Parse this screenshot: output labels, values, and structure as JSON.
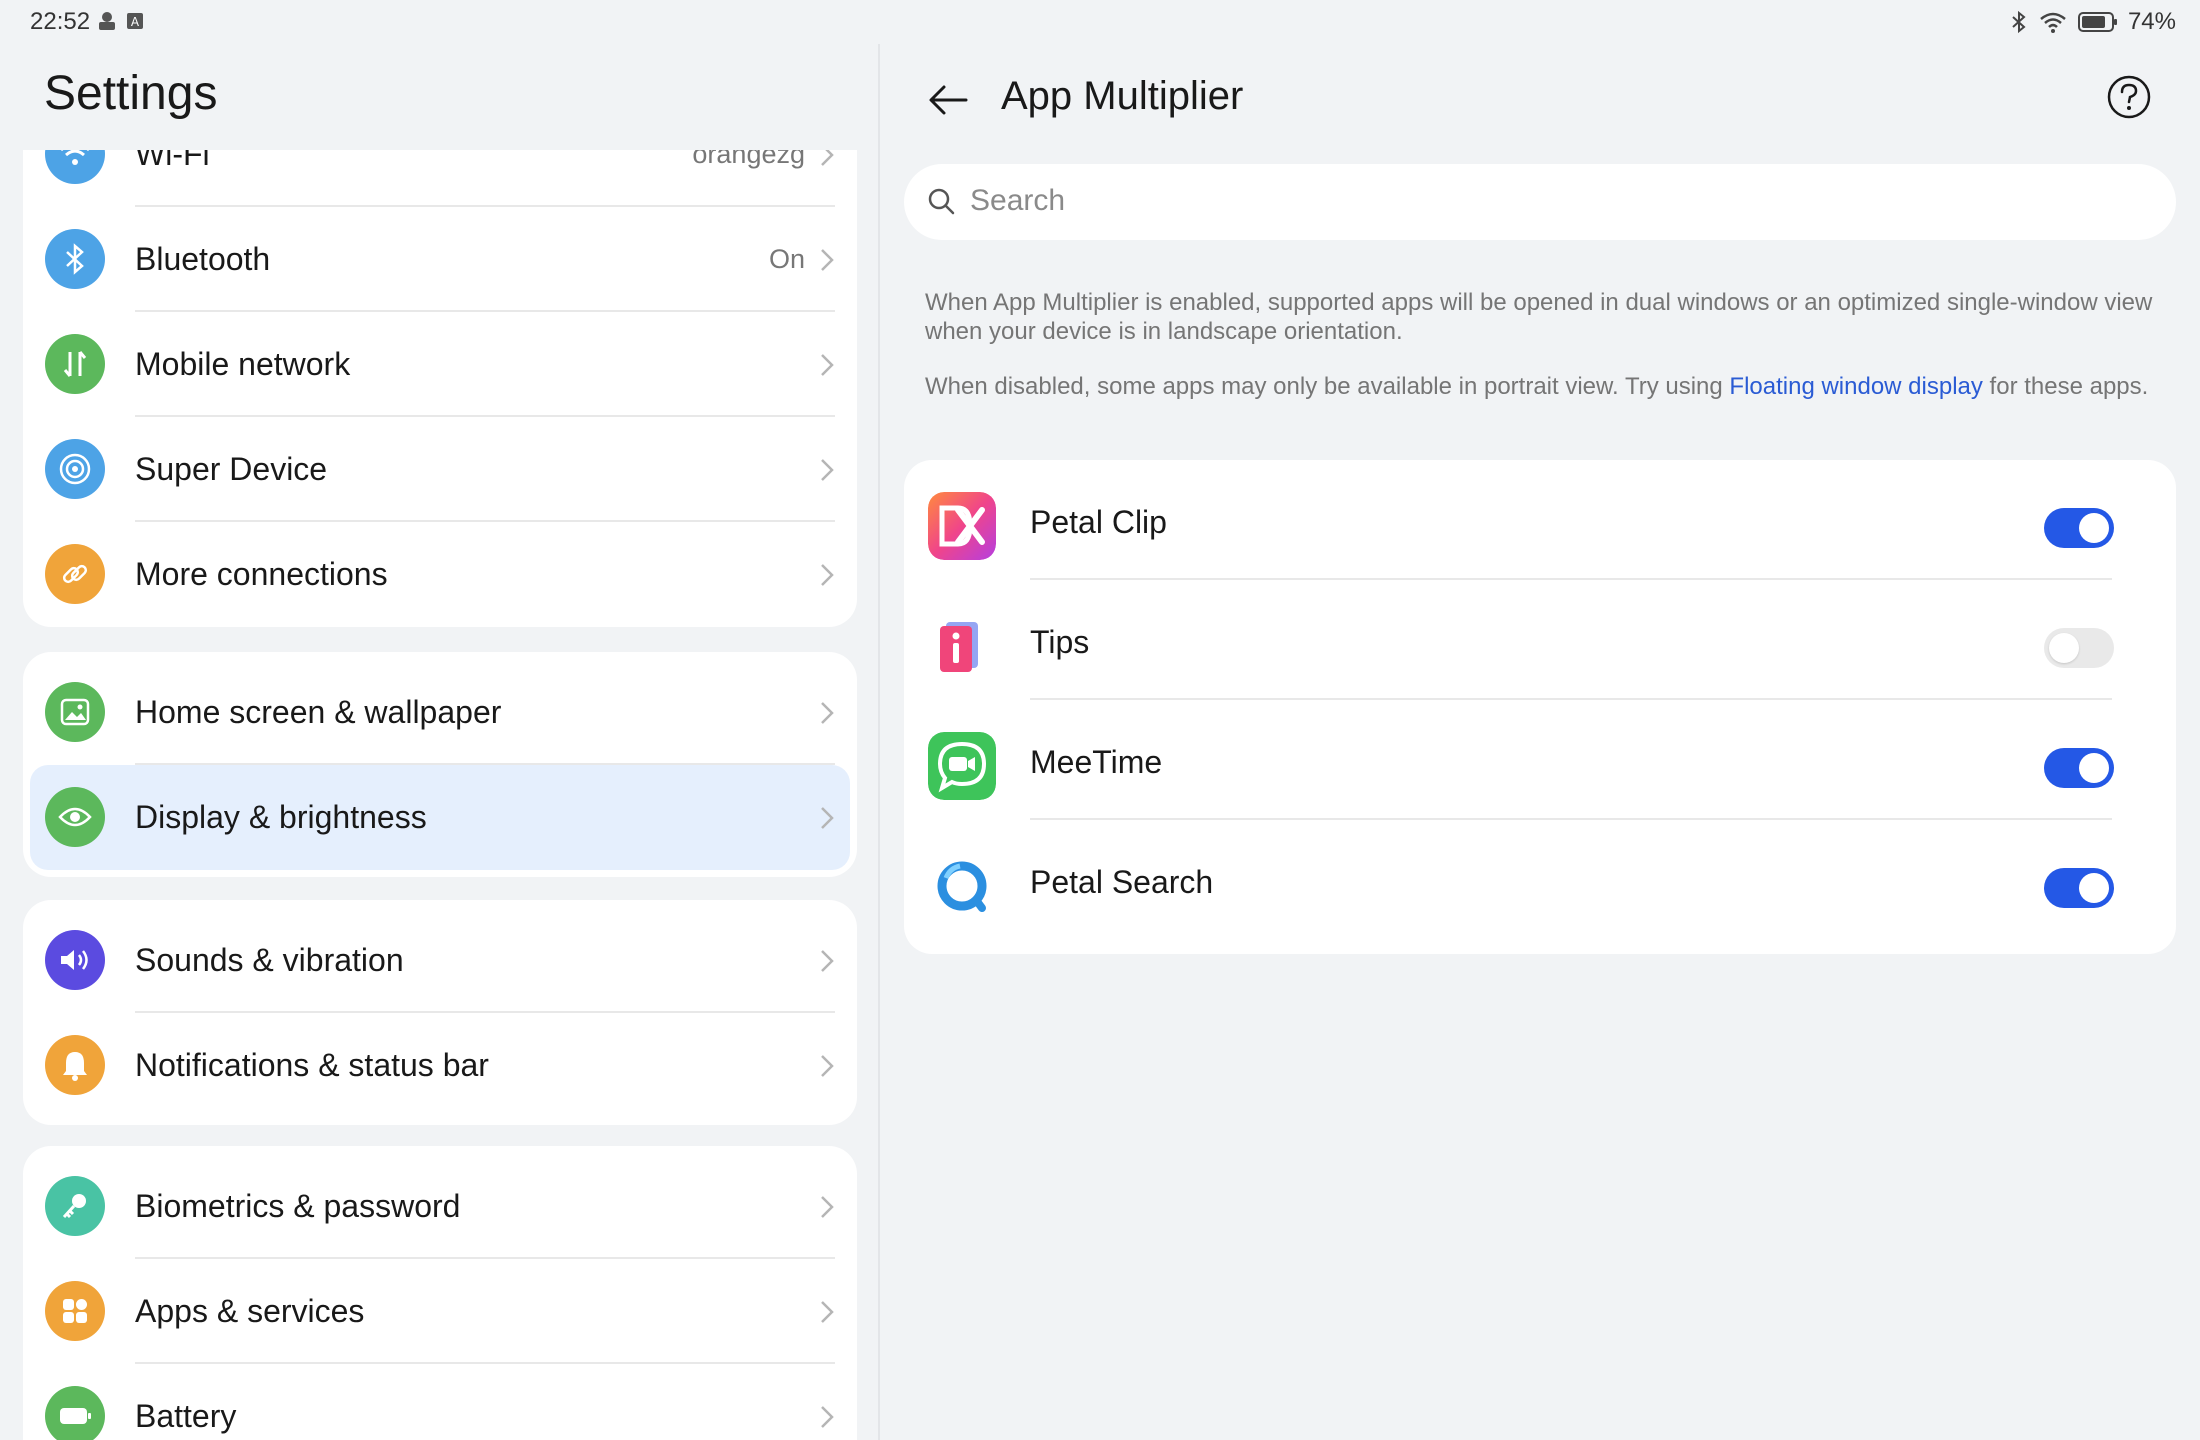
{
  "status_bar": {
    "time": "22:52",
    "battery": "74%"
  },
  "left": {
    "title": "Settings",
    "groups": [
      {
        "items": [
          {
            "label": "Wi-Fi",
            "value": "orangezg",
            "icon": "wifi-icon",
            "color": "#4da3e6"
          },
          {
            "label": "Bluetooth",
            "value": "On",
            "icon": "bluetooth-icon",
            "color": "#4da3e6"
          },
          {
            "label": "Mobile network",
            "value": "",
            "icon": "mobile-network-icon",
            "color": "#5cb85c"
          },
          {
            "label": "Super Device",
            "value": "",
            "icon": "super-device-icon",
            "color": "#4da3e6"
          },
          {
            "label": "More connections",
            "value": "",
            "icon": "link-icon",
            "color": "#f0a43a"
          }
        ]
      },
      {
        "items": [
          {
            "label": "Home screen & wallpaper",
            "value": "",
            "icon": "wallpaper-icon",
            "color": "#5cb85c"
          },
          {
            "label": "Display & brightness",
            "value": "",
            "icon": "eye-icon",
            "color": "#5cb85c",
            "selected": true
          }
        ]
      },
      {
        "items": [
          {
            "label": "Sounds & vibration",
            "value": "",
            "icon": "speaker-icon",
            "color": "#5b4be0"
          },
          {
            "label": "Notifications & status bar",
            "value": "",
            "icon": "bell-icon",
            "color": "#f0a43a"
          }
        ]
      },
      {
        "items": [
          {
            "label": "Biometrics & password",
            "value": "",
            "icon": "key-icon",
            "color": "#49c3a4"
          },
          {
            "label": "Apps & services",
            "value": "",
            "icon": "apps-icon",
            "color": "#f0a43a"
          },
          {
            "label": "Battery",
            "value": "",
            "icon": "battery-icon",
            "color": "#5cb85c"
          }
        ]
      }
    ]
  },
  "right": {
    "title": "App Multiplier",
    "search_placeholder": "Search",
    "desc1": "When App Multiplier is enabled, supported apps will be opened in dual windows or an optimized single-window view when your device is in landscape orientation.",
    "desc2_before": "When disabled, some apps may only be available in portrait view. Try using ",
    "desc2_link": "Floating window display",
    "desc2_after": " for these apps.",
    "apps": [
      {
        "label": "Petal Clip",
        "enabled": true,
        "icon": "petal-clip-icon"
      },
      {
        "label": "Tips",
        "enabled": false,
        "icon": "tips-icon"
      },
      {
        "label": "MeeTime",
        "enabled": true,
        "icon": "meetime-icon"
      },
      {
        "label": "Petal Search",
        "enabled": true,
        "icon": "petal-search-icon"
      }
    ]
  },
  "colors": {
    "accent": "#2458e6",
    "link": "#2a5bd4",
    "selected_bg": "#e5effd",
    "background": "#f1f3f5"
  }
}
